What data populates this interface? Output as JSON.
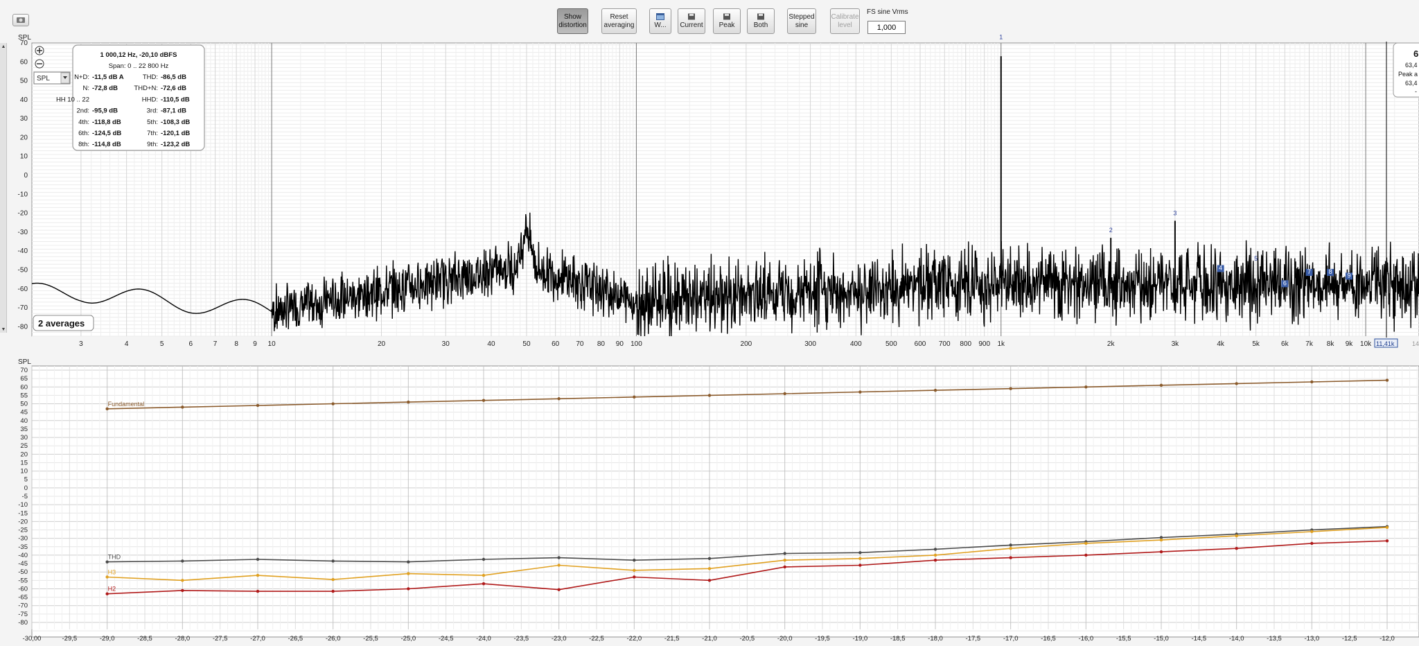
{
  "toolbar": {
    "show_distortion": [
      "Show",
      "distortion"
    ],
    "reset_averaging": [
      "Reset",
      "averaging"
    ],
    "window": "W...",
    "current": "Current",
    "peak": "Peak",
    "both": "Both",
    "stepped_sine": [
      "Stepped",
      "sine"
    ],
    "calibrate_level": [
      "Calibrate",
      "level"
    ],
    "fs_label": "FS sine Vrms",
    "fs_value": "1,000"
  },
  "top_chart": {
    "spl_label": "SPL",
    "mode_select": "SPL",
    "y_ticks": [
      "70",
      "60",
      "50",
      "40",
      "30",
      "20",
      "10",
      "0",
      "-10",
      "-20",
      "-30",
      "-40",
      "-50",
      "-60",
      "-70",
      "-80"
    ],
    "x_ticks": [
      "3",
      "4",
      "5",
      "6",
      "7",
      "8",
      "9",
      "10",
      "20",
      "30",
      "40",
      "50",
      "60",
      "70",
      "80",
      "90",
      "100",
      "200",
      "300",
      "400",
      "500",
      "600",
      "700",
      "800",
      "900",
      "1k",
      "2k",
      "3k",
      "4k",
      "5k",
      "6k",
      "7k",
      "8k",
      "9k",
      "10k"
    ],
    "x_tick_values": [
      3,
      4,
      5,
      6,
      7,
      8,
      9,
      10,
      20,
      30,
      40,
      50,
      60,
      70,
      80,
      90,
      100,
      200,
      300,
      400,
      500,
      600,
      700,
      800,
      900,
      1000,
      2000,
      3000,
      4000,
      5000,
      6000,
      7000,
      8000,
      9000,
      10000
    ],
    "cursor_label": "11,41k",
    "right_edge_label": "14",
    "averages_badge": "2 averages",
    "harmonic_markers": [
      "1",
      "2",
      "3",
      "4",
      "5",
      "6",
      "7",
      "8",
      "9"
    ],
    "info": {
      "header": "1 000,12 Hz, -20,10 dBFS",
      "span": "Span: 0 .. 22 800 Hz",
      "rows": [
        {
          "l1": "N+D:",
          "v1": "-11,5 dB A",
          "l2": "THD:",
          "v2": "-86,5 dB"
        },
        {
          "l1": "N:",
          "v1": "-72,8 dB",
          "l2": "THD+N:",
          "v2": "-72,6 dB"
        },
        {
          "l1": "HH 10 .. 22",
          "v1": "",
          "l2": "HHD:",
          "v2": "-110,5 dB"
        },
        {
          "l1": "2nd:",
          "v1": "-95,9 dB",
          "l2": "3rd:",
          "v2": "-87,1 dB"
        },
        {
          "l1": "4th:",
          "v1": "-118,8 dB",
          "l2": "5th:",
          "v2": "-108,3 dB"
        },
        {
          "l1": "6th:",
          "v1": "-124,5 dB",
          "l2": "7th:",
          "v2": "-120,1 dB"
        },
        {
          "l1": "8th:",
          "v1": "-114,8 dB",
          "l2": "9th:",
          "v2": "-123,2 dB"
        }
      ]
    },
    "right_info": [
      "6",
      "63,4",
      "Peak a",
      "63,4",
      "-"
    ]
  },
  "bottom_chart": {
    "spl_label": "SPL",
    "y_ticks": [
      "70",
      "65",
      "60",
      "55",
      "50",
      "45",
      "40",
      "35",
      "30",
      "25",
      "20",
      "15",
      "10",
      "5",
      "0",
      "-5",
      "-10",
      "-15",
      "-20",
      "-25",
      "-30",
      "-35",
      "-40",
      "-45",
      "-50",
      "-55",
      "-60",
      "-65",
      "-70",
      "-75",
      "-80"
    ],
    "x_ticks": [
      "-30,00",
      "-29,5",
      "-29,0",
      "-28,5",
      "-28,0",
      "-27,5",
      "-27,0",
      "-26,5",
      "-26,0",
      "-25,5",
      "-25,0",
      "-24,5",
      "-24,0",
      "-23,5",
      "-23,0",
      "-22,5",
      "-22,0",
      "-21,5",
      "-21,0",
      "-20,5",
      "-20,0",
      "-19,5",
      "-19,0",
      "-18,5",
      "-18,0",
      "-17,5",
      "-17,0",
      "-16,5",
      "-16,0",
      "-15,5",
      "-15,0",
      "-14,5",
      "-14,0",
      "-13,5",
      "-13,0",
      "-12,5",
      "-12,0"
    ]
  },
  "chart_data": [
    {
      "type": "line",
      "xlabel": "",
      "ylabel": "SPL",
      "x_scale": "log",
      "xlim": [
        2.2,
        14000
      ],
      "ylim": [
        -85,
        70
      ],
      "grid": true,
      "spikes": [
        {
          "x": 1000,
          "y": 63,
          "label": "1"
        },
        {
          "x": 2000,
          "y": -33,
          "label": "2"
        },
        {
          "x": 3000,
          "y": -24,
          "label": "3"
        }
      ],
      "noise_floor_envelope": {
        "x": [
          3,
          10,
          50,
          100,
          1000,
          10000
        ],
        "y": [
          -50,
          -60,
          -35,
          -55,
          -45,
          -45
        ]
      }
    },
    {
      "type": "line",
      "xlabel": "",
      "ylabel": "SPL",
      "xlim": [
        -30,
        -12
      ],
      "ylim": [
        -85,
        70
      ],
      "grid": true,
      "x": [
        -29,
        -28,
        -27,
        -26,
        -25,
        -24,
        -23,
        -22,
        -21,
        -20,
        -19,
        -18,
        -17,
        -16,
        -15,
        -14,
        -13,
        -12
      ],
      "series": [
        {
          "name": "Fundamental",
          "color": "#8a5a2b",
          "values": [
            47,
            48,
            49,
            50,
            51,
            52,
            53,
            54,
            55,
            56,
            57,
            58,
            59,
            60,
            61,
            62,
            63,
            64
          ]
        },
        {
          "name": "THD",
          "color": "#4a4a4a",
          "values": [
            -44,
            -43.5,
            -42.5,
            -43.5,
            -44,
            -42.5,
            -41.5,
            -43,
            -42,
            -39,
            -38.5,
            -36.5,
            -34,
            -32,
            -29.5,
            -27.5,
            -25,
            -23
          ]
        },
        {
          "name": "H3",
          "color": "#e0a020",
          "values": [
            -53,
            -55,
            -52,
            -54.5,
            -51,
            -52,
            -46,
            -49,
            -48,
            -43,
            -42,
            -40,
            -36,
            -33,
            -31,
            -28.5,
            -26,
            -23.5
          ]
        },
        {
          "name": "H2",
          "color": "#b01818",
          "values": [
            -63,
            -61,
            -61.5,
            -61.5,
            -60,
            -57,
            -60.5,
            -53,
            -55,
            -47,
            -46,
            -43,
            -41.5,
            -40,
            -38,
            -36,
            -33,
            -31.5
          ]
        }
      ]
    }
  ]
}
